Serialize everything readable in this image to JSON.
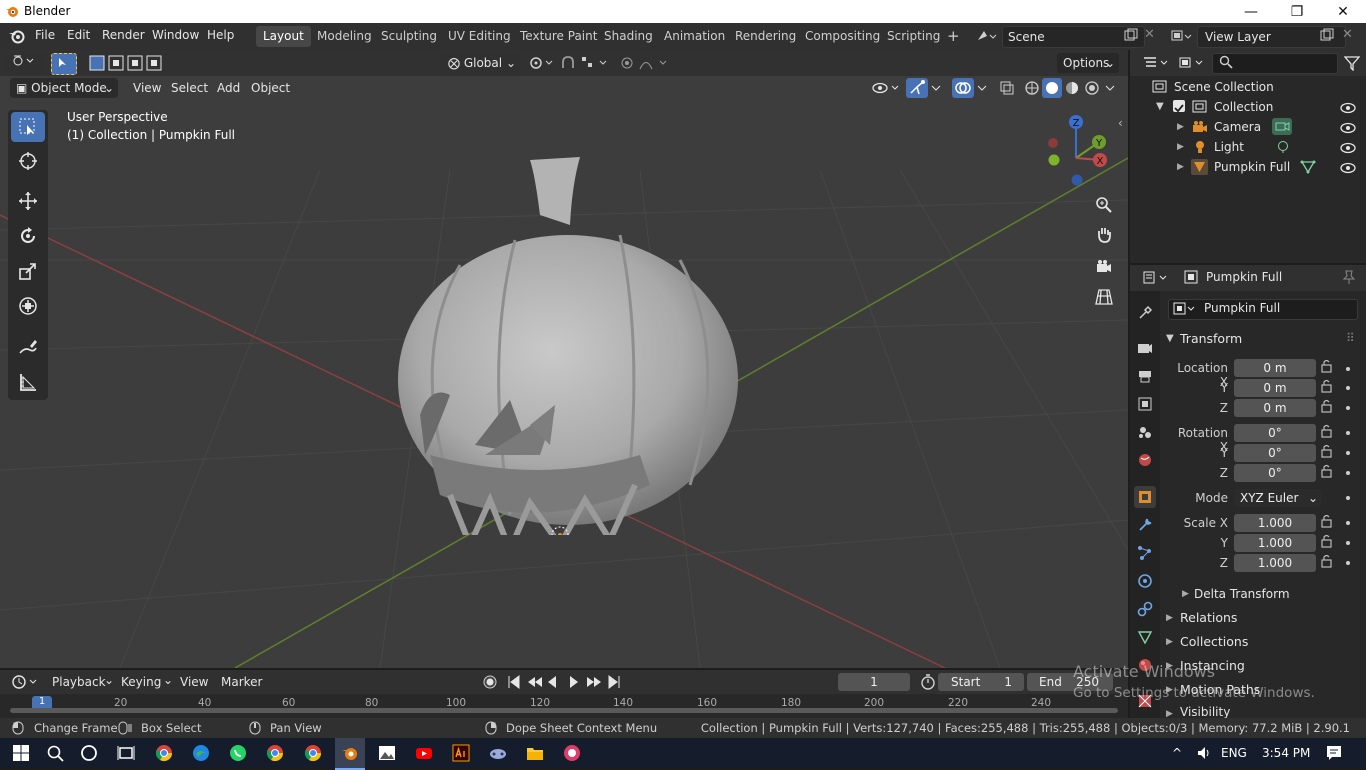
{
  "window": {
    "title": "Blender",
    "minimize": "—",
    "maximize": "❐",
    "close": "✕"
  },
  "menu": {
    "file": "File",
    "edit": "Edit",
    "render": "Render",
    "window": "Window",
    "help": "Help"
  },
  "workspaces": [
    "Layout",
    "Modeling",
    "Sculpting",
    "UV Editing",
    "Texture Paint",
    "Shading",
    "Animation",
    "Rendering",
    "Compositing",
    "Scripting"
  ],
  "add_workspace": "+",
  "scene": {
    "name": "Scene"
  },
  "view_layer": {
    "name": "View Layer"
  },
  "viewport": {
    "transform_orientation": "Global",
    "options_label": "Options",
    "mode": "Object Mode",
    "menus": {
      "view": "View",
      "select": "Select",
      "add": "Add",
      "object": "Object"
    },
    "perspective": "User Perspective",
    "collection_info": "(1) Collection | Pumpkin Full",
    "gizmo": {
      "x": "X",
      "y": "Y",
      "z": "Z"
    }
  },
  "outliner": {
    "search_placeholder": "",
    "items": [
      {
        "label": "Scene Collection"
      },
      {
        "label": "Collection"
      },
      {
        "label": "Camera"
      },
      {
        "label": "Light"
      },
      {
        "label": "Pumpkin Full"
      }
    ]
  },
  "properties": {
    "header_object": "Pumpkin Full",
    "object_name": "Pumpkin Full",
    "transform_title": "Transform",
    "location": {
      "label": "Location X",
      "x": "0 m",
      "y": "0 m",
      "z": "0 m"
    },
    "rotation": {
      "label": "Rotation X",
      "x": "0°",
      "y": "0°",
      "z": "0°"
    },
    "mode": {
      "label": "Mode",
      "value": "XYZ Euler"
    },
    "scale": {
      "label": "Scale X",
      "x": "1.000",
      "y": "1.000",
      "z": "1.000"
    },
    "axis_labels": {
      "y": "Y",
      "z": "Z"
    },
    "sections": [
      "Delta Transform",
      "Relations",
      "Collections",
      "Instancing",
      "Motion Paths",
      "Visibility"
    ]
  },
  "timeline": {
    "menus": {
      "playback": "Playback",
      "keying": "Keying",
      "view": "View",
      "marker": "Marker"
    },
    "current_frame": "1",
    "start_label": "Start",
    "start_value": "1",
    "end_label": "End",
    "end_value": "250",
    "ruler": [
      "1",
      "20",
      "40",
      "60",
      "80",
      "100",
      "120",
      "140",
      "160",
      "180",
      "200",
      "220",
      "240"
    ]
  },
  "statusbar": {
    "change_frame": "Change Frame",
    "box_select": "Box Select",
    "pan_view": "Pan View",
    "context_menu": "Dope Sheet Context Menu",
    "stats": "Collection | Pumpkin Full | Verts:127,740 | Faces:255,488 | Tris:255,488 | Objects:0/3 | Memory: 77.2 MiB | 2.90.1"
  },
  "watermark": {
    "line1": "Activate Windows",
    "line2": "Go to Settings to activate Windows."
  },
  "taskbar": {
    "language": "ENG",
    "time": "3:54 PM"
  },
  "colors": {
    "accent": "#4772b3",
    "x_axis": "#c44a4a",
    "y_axis": "#6e9d2c",
    "z_axis": "#3b6fd1"
  }
}
